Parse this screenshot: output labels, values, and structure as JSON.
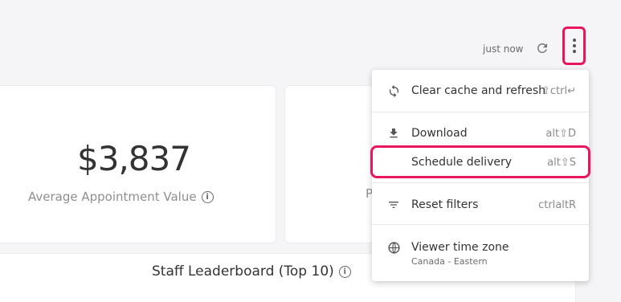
{
  "header": {
    "updated_label": "just now"
  },
  "cards": [
    {
      "value": "$3,837",
      "label": "Average Appointment Value"
    },
    {
      "label_fragment": "P"
    }
  ],
  "leaderboard": {
    "title": "Staff Leaderboard (Top 10)"
  },
  "menu": {
    "items": [
      {
        "label": "Clear cache and refresh",
        "shortcut": "⇧ctrl↵",
        "icon": "sync-icon"
      },
      {
        "label": "Download",
        "shortcut": "alt⇧D",
        "icon": "download-icon"
      },
      {
        "label": "Schedule delivery",
        "shortcut": "alt⇧S",
        "icon": ""
      },
      {
        "label": "Reset filters",
        "shortcut": "ctrlaltR",
        "icon": "filter-icon"
      },
      {
        "label": "Viewer time zone",
        "sublabel": "Canada - Eastern",
        "icon": "globe-icon"
      }
    ]
  },
  "colors": {
    "highlight": "#e8175d"
  }
}
